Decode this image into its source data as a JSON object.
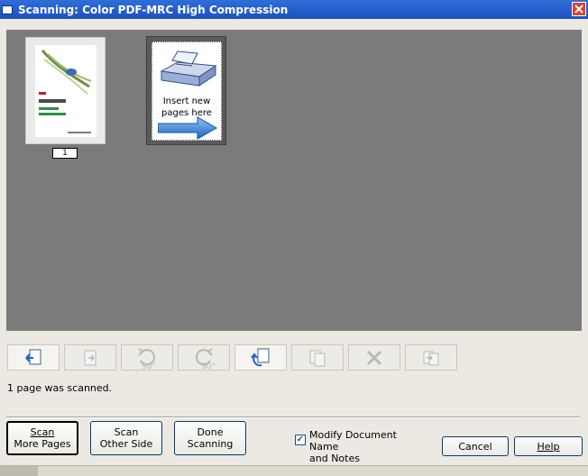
{
  "window": {
    "title": "Scanning: Color PDF-MRC High Compression",
    "close_icon": "close-icon"
  },
  "preview": {
    "page_thumbnail": {
      "page_number": "1",
      "cover_lines": [
        "Adobe",
        "Photoshop CS",
        "Дизайн",
        "Ландшафтов"
      ]
    },
    "insert_placeholder": {
      "text": "Insert new pages here",
      "icon": "scanner-icon",
      "arrow_icon": "arrow-right-icon"
    }
  },
  "toolbar": {
    "buttons": [
      {
        "name": "insert-page-icon",
        "enabled": true
      },
      {
        "name": "move-page-icon",
        "enabled": false
      },
      {
        "name": "rotate-left-icon",
        "enabled": false,
        "label": "90°"
      },
      {
        "name": "rotate-right-icon",
        "enabled": false,
        "label": "90°"
      },
      {
        "name": "rotate-page-icon",
        "enabled": true
      },
      {
        "name": "reorder-icon",
        "enabled": false
      },
      {
        "name": "delete-icon",
        "enabled": false
      },
      {
        "name": "replace-icon",
        "enabled": false
      }
    ]
  },
  "status": {
    "text": "1 page was scanned."
  },
  "footer": {
    "scan_more_line1": "Scan",
    "scan_more_line2": "More Pages",
    "scan_other_line1": "Scan",
    "scan_other_line2": "Other Side",
    "done_line1": "Done",
    "done_line2": "Scanning",
    "modify_label_line1": "Modify Document Name",
    "modify_label_line2": "and Notes",
    "modify_checked": "✓",
    "cancel_label": "Cancel",
    "help_label": "Help"
  },
  "colors": {
    "title_bar": "#1c4fc0",
    "preview_bg": "#7b7b7b",
    "dialog_bg": "#ece9e2",
    "button_border": "#003c74"
  }
}
